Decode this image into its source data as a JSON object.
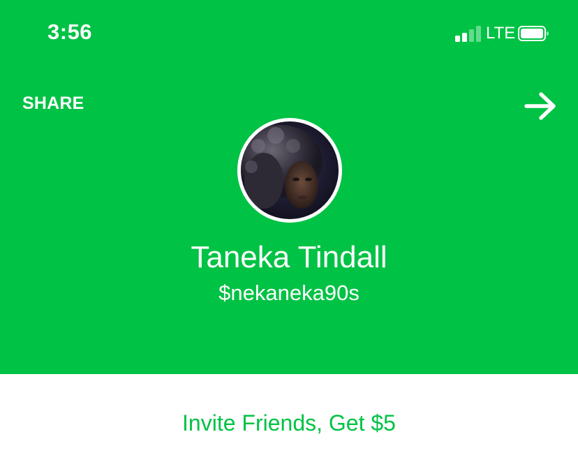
{
  "status_bar": {
    "time": "3:56",
    "network": "LTE",
    "signal_bars_filled": 2,
    "signal_bars_total": 4,
    "battery_level": 1.0
  },
  "header": {
    "share_label": "SHARE",
    "forward_icon": "arrow-right-icon",
    "avatar_alt": "profile photo"
  },
  "profile": {
    "name": "Taneka Tindall",
    "cashtag": "$nekaneka90s"
  },
  "invite": {
    "label": "Invite Friends, Get $5"
  },
  "colors": {
    "brand_green": "#00c244",
    "text_on_brand": "#ffffff",
    "background": "#ffffff"
  }
}
